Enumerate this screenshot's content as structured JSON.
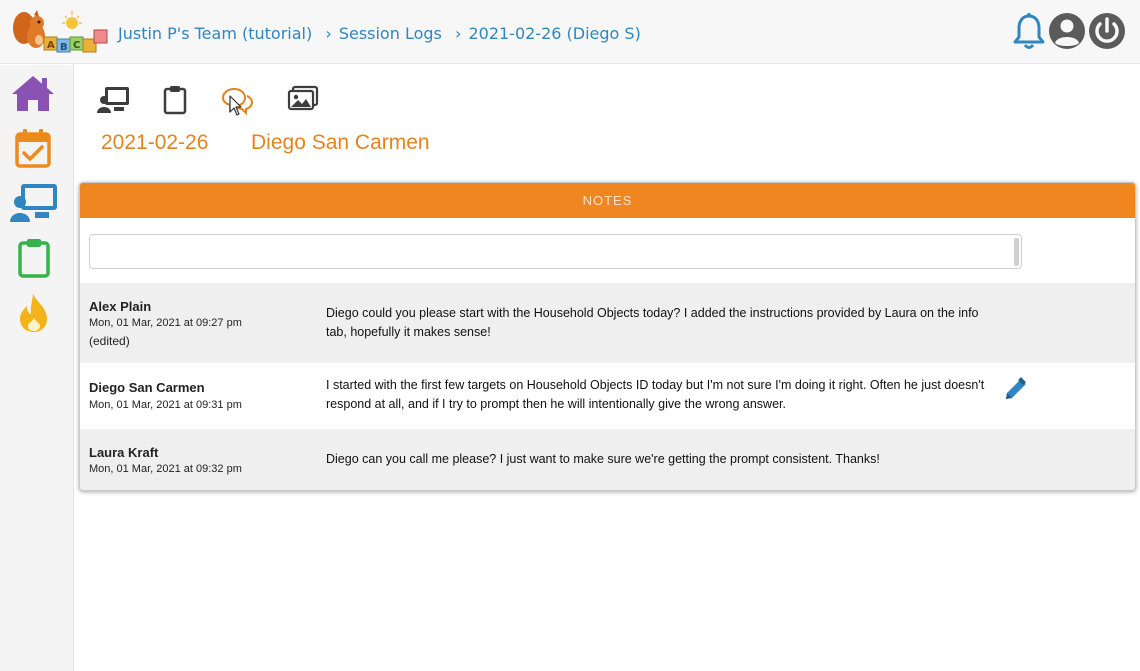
{
  "app": {
    "logo_text": "ABC",
    "colors": {
      "accent": "#ef861f",
      "link": "#2f86c0",
      "sidebar_purple": "#8a53b3",
      "sidebar_orange": "#ec8a1c",
      "sidebar_blue": "#2f86c0",
      "sidebar_green": "#35b34a",
      "sidebar_yellow": "#f3b41b"
    }
  },
  "breadcrumb": {
    "items": [
      {
        "label": "Justin P's Team (tutorial)"
      },
      {
        "label": "Session Logs"
      },
      {
        "label": "2021-02-26 (Diego S)"
      }
    ],
    "separator": "›"
  },
  "topbar": {
    "icons": [
      "bell-icon",
      "user-icon",
      "power-icon"
    ]
  },
  "sidebar": {
    "items": [
      {
        "name": "home",
        "icon": "home-icon"
      },
      {
        "name": "calendar",
        "icon": "calendar-check-icon"
      },
      {
        "name": "sessions",
        "icon": "presenter-icon"
      },
      {
        "name": "clipboard",
        "icon": "clipboard-icon"
      },
      {
        "name": "fire",
        "icon": "fire-icon"
      }
    ]
  },
  "session_tabs": {
    "items": [
      {
        "name": "presenter",
        "icon": "presenter-icon",
        "active": false
      },
      {
        "name": "clipboard",
        "icon": "clipboard-icon",
        "active": false
      },
      {
        "name": "comments",
        "icon": "comments-icon",
        "active": true
      },
      {
        "name": "images",
        "icon": "images-icon",
        "active": false
      }
    ]
  },
  "session": {
    "date": "2021-02-26",
    "client": "Diego San Carmen"
  },
  "notes": {
    "header": "NOTES",
    "input": {
      "value": "",
      "placeholder": ""
    },
    "items": [
      {
        "author": "Alex Plain",
        "timestamp": "Mon, 01 Mar, 2021 at 09:27 pm",
        "edited": "(edited)",
        "text": "Diego could you please start with the Household Objects today? I added the instructions provided by Laura on the info tab, hopefully it makes sense!"
      },
      {
        "author": "Diego San Carmen",
        "timestamp": "Mon, 01 Mar, 2021 at 09:31 pm",
        "edited": "",
        "text": "I started with the first few targets on Household Objects ID today but I'm not sure I'm doing it right. Often he just doesn't respond at all, and if I try to prompt then he will intentionally give the wrong answer.",
        "editable": true
      },
      {
        "author": "Laura Kraft",
        "timestamp": "Mon, 01 Mar, 2021 at 09:32 pm",
        "edited": "",
        "text": "Diego can you call me please? I just want to make sure we're getting the prompt consistent. Thanks!"
      }
    ]
  }
}
